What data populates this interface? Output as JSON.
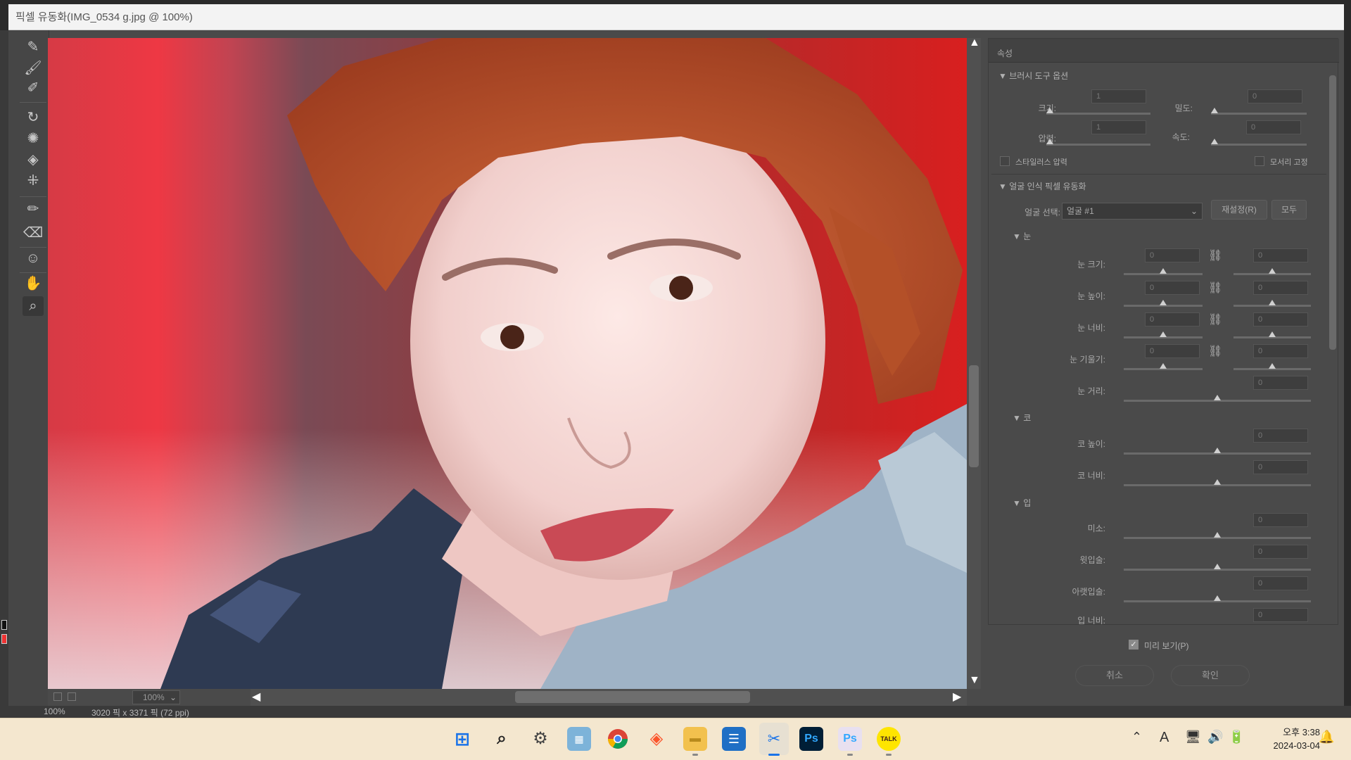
{
  "window": {
    "title": "픽셀 유동화(IMG_0534 g.jpg @ 100%)"
  },
  "tools": [
    "warp-tool",
    "reconstruct-tool",
    "smooth-tool",
    "twirl-tool",
    "pucker-tool",
    "bloat-tool",
    "push-left-tool",
    "freeze-mask-tool",
    "thaw-mask-tool",
    "face-tool",
    "hand-tool",
    "zoom-tool"
  ],
  "canvas": {
    "zoom": "100%"
  },
  "background_status": {
    "zoom": "100%",
    "info": "3020 픽 x 3371 픽 (72 ppi)"
  },
  "properties": {
    "title": "속성",
    "brush": {
      "header": "브러시 도구 옵션",
      "size_label": "크기:",
      "size_value": "1",
      "density_label": "밀도:",
      "density_value": "0",
      "pressure_label": "압력:",
      "pressure_value": "1",
      "rate_label": "속도:",
      "rate_value": "0",
      "stylus_label": "스타일러스 압력",
      "pin_edges_label": "모서리 고정"
    },
    "face": {
      "header": "얼굴 인식 픽셀 유동화",
      "select_label": "얼굴 선택:",
      "select_value": "얼굴 #1",
      "reset_button": "재설정(R)",
      "all_button": "모두",
      "eyes": {
        "header": "눈",
        "rows": [
          {
            "label": "눈 크기:",
            "left": "0",
            "right": "0"
          },
          {
            "label": "눈 높이:",
            "left": "0",
            "right": "0"
          },
          {
            "label": "눈 너비:",
            "left": "0",
            "right": "0"
          },
          {
            "label": "눈 기울기:",
            "left": "0",
            "right": "0"
          }
        ],
        "distance_label": "눈 거리:",
        "distance_value": "0"
      },
      "nose": {
        "header": "코",
        "height_label": "코 높이:",
        "height_value": "0",
        "width_label": "코 너비:",
        "width_value": "0"
      },
      "mouth": {
        "header": "입",
        "smile_label": "미소:",
        "smile_value": "0",
        "upper_label": "윗입술:",
        "upper_value": "0",
        "lower_label": "아랫입술:",
        "lower_value": "0",
        "width_label": "입 너비:",
        "width_value": "0"
      }
    },
    "preview_label": "미리 보기(P)",
    "cancel_button": "취소",
    "ok_button": "확인"
  },
  "taskbar": {
    "ps1": "Ps",
    "ps2": "Ps",
    "talk": "TALK",
    "input_indicator": "A",
    "time_period": "오후 3:38",
    "date": "2024-03-04"
  }
}
